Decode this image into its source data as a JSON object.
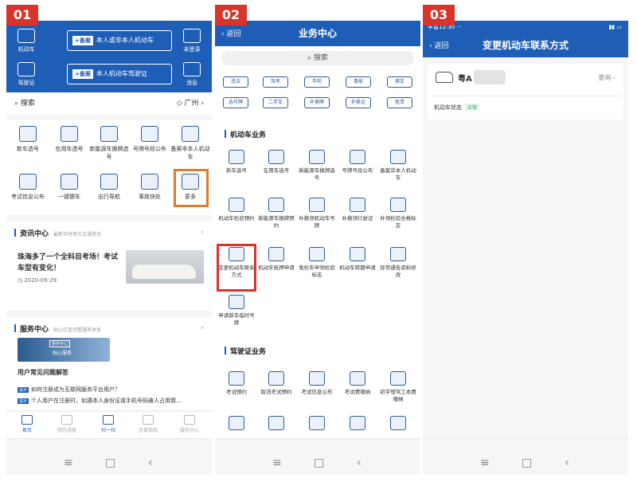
{
  "badges": [
    "01",
    "02",
    "03"
  ],
  "p1": {
    "top_left": "机动车",
    "top_left2": "驾驶证",
    "top_right": "未登录",
    "top_right2": "消息",
    "lic1_tag": "+备案",
    "lic1": "本人或非本人机动车",
    "lic2_tag": "+备案",
    "lic2": "本人机动车驾驶证",
    "search": "搜索",
    "city": "广州",
    "grid": [
      "新车选号",
      "在用车选号",
      "新能源车换牌选号",
      "号牌号段公布",
      "备案非本人机动车",
      "考试信息公布",
      "一键挪车",
      "出行导航",
      "事故快处",
      "更多"
    ],
    "news_title": "资讯中心",
    "news_sub": "最新实时地方交通资讯",
    "news_text": "珠海多了一个全科目考场！考试车型有变化！",
    "news_date": "2020-09-29",
    "service_title": "服务中心",
    "service_sub": "贴心打造完整服务体系",
    "banner_tag": "服务中心",
    "banner_text": "贴心服务",
    "faq_title": "用户常见问题解答",
    "faq1": "如何注册成为互联网服务平台用户？",
    "faq2": "个人用户在注册时，如遇本人身份证或手机号码被人占用情…",
    "faq_tag": "提示",
    "tabs": [
      "首页",
      "网办进度",
      "扫一扫",
      "办事指南",
      "服务中心"
    ]
  },
  "p2": {
    "back": "返回",
    "title": "业务中心",
    "search": "搜索",
    "chips": [
      "违法",
      "驾考",
      "年检",
      "事故",
      "挪车",
      "选号牌",
      "二手车",
      "补换牌",
      "补换证",
      "租赁"
    ],
    "sec1": "机动车业务",
    "grid1": [
      "新车选号",
      "在用车选号",
      "新能源车换牌选号",
      "号牌号段公布",
      "备案非本人机动车",
      "机动车检验预约",
      "新能源车换牌预约",
      "补换领机动车号牌",
      "补换领行驶证",
      "补领检验合格标志",
      "变更机动车联系方式",
      "机动车抵押申请",
      "免检车申领检验标志",
      "机动车转籍申请",
      "异常通告资料修改",
      "申请新车临时号牌"
    ],
    "sec2": "驾驶证业务",
    "grid2": [
      "考试预约",
      "取消考试预约",
      "考试信息公布",
      "考试费缴纳",
      "初学增驾工本费缴纳"
    ]
  },
  "p3": {
    "time": "丰富12:30",
    "dots": "···",
    "back": "返回",
    "title": "变更机动车联系方式",
    "plate": "粤A",
    "query": "查询",
    "status_label": "机动车状态",
    "status": "正常"
  },
  "nav": [
    "≡",
    "□",
    "‹"
  ]
}
